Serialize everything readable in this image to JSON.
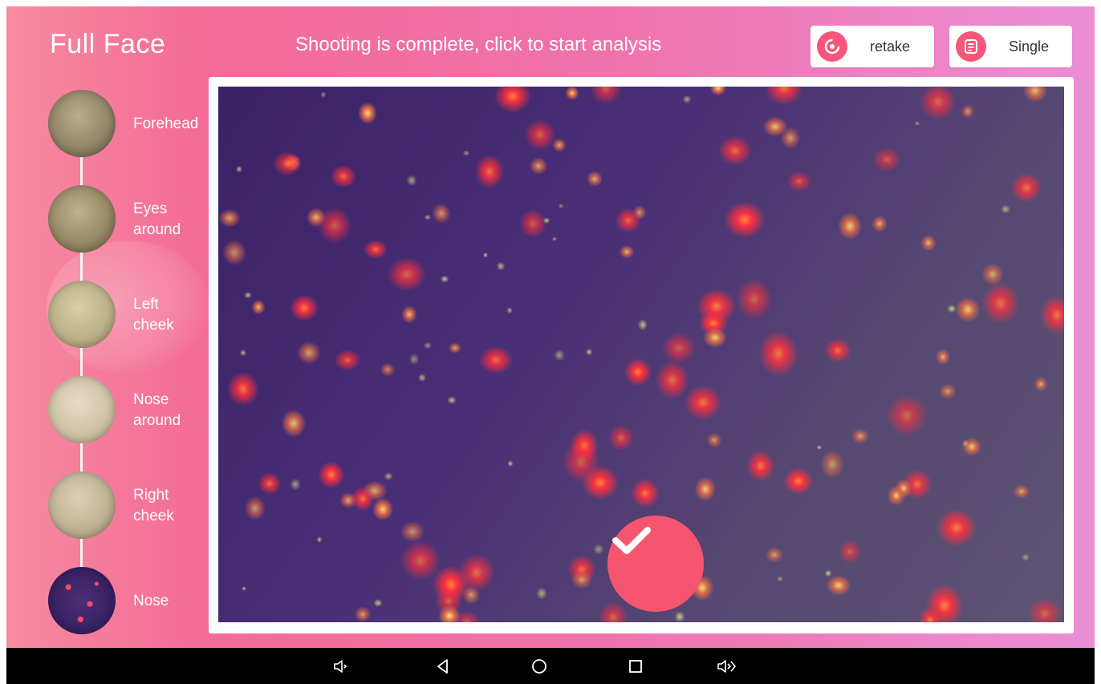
{
  "header": {
    "title": "Full Face",
    "status": "Shooting is complete, click to start analysis",
    "retake_label": "retake",
    "single_label": "Single"
  },
  "sidebar": {
    "items": [
      {
        "label": "Forehead"
      },
      {
        "label": "Eyes\naround"
      },
      {
        "label": "Left\ncheek",
        "selected": true
      },
      {
        "label": "Nose\naround"
      },
      {
        "label": "Right\ncheek"
      },
      {
        "label": "Nose"
      }
    ]
  },
  "colors": {
    "accent": "#f5556f",
    "gradient_start": "#f78aa0",
    "gradient_end": "#eb8ed6",
    "navbar": "#000000"
  },
  "icons": {
    "retake": "refresh-icon",
    "single": "document-icon",
    "confirm": "checkmark-icon",
    "nav": [
      "volume-down-icon",
      "back-icon",
      "home-icon",
      "recents-icon",
      "volume-up-icon"
    ]
  }
}
